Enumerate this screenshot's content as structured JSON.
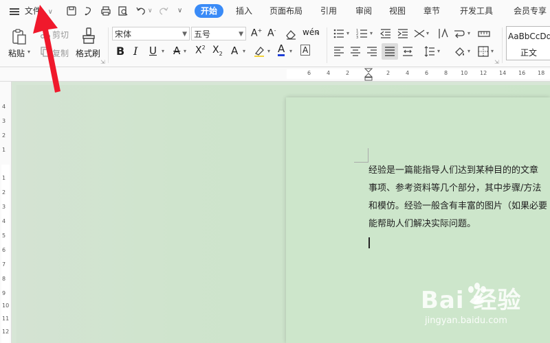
{
  "menu": {
    "file_label": "文件",
    "tabs": [
      {
        "label": "开始"
      },
      {
        "label": "插入"
      },
      {
        "label": "页面布局"
      },
      {
        "label": "引用"
      },
      {
        "label": "审阅"
      },
      {
        "label": "视图"
      },
      {
        "label": "章节"
      },
      {
        "label": "开发工具"
      },
      {
        "label": "会员专享"
      }
    ]
  },
  "ribbon": {
    "paste_label": "粘贴",
    "cut_label": "剪切",
    "copy_label": "复制",
    "format_painter_label": "格式刷",
    "font_name": "宋体",
    "font_size": "五号",
    "style_preview": "AaBbCcDd",
    "style_name": "正文"
  },
  "ruler": {
    "horizontal": [
      "6",
      "4",
      "2",
      "2",
      "4",
      "6",
      "8",
      "10",
      "12",
      "14",
      "16",
      "18"
    ],
    "vertical": [
      "4",
      "3",
      "2",
      "1",
      "1",
      "2",
      "3",
      "4",
      "5",
      "6",
      "7",
      "8",
      "9",
      "10",
      "11",
      "12"
    ]
  },
  "document": {
    "lines": [
      "经验是一篇能指导人们达到某种目的的文章",
      "事项、参考资料等几个部分，其中步骤/方法",
      "和模仿。经验一般含有丰富的图片（如果必要",
      "能帮助人们解决实际问题。"
    ]
  },
  "watermark": {
    "brand": "Bai 经验",
    "url": "jingyan.baidu.com"
  },
  "colors": {
    "accent": "#3a8bf7",
    "annotation_arrow": "#f0192c",
    "canvas": "#d4e6d2"
  }
}
